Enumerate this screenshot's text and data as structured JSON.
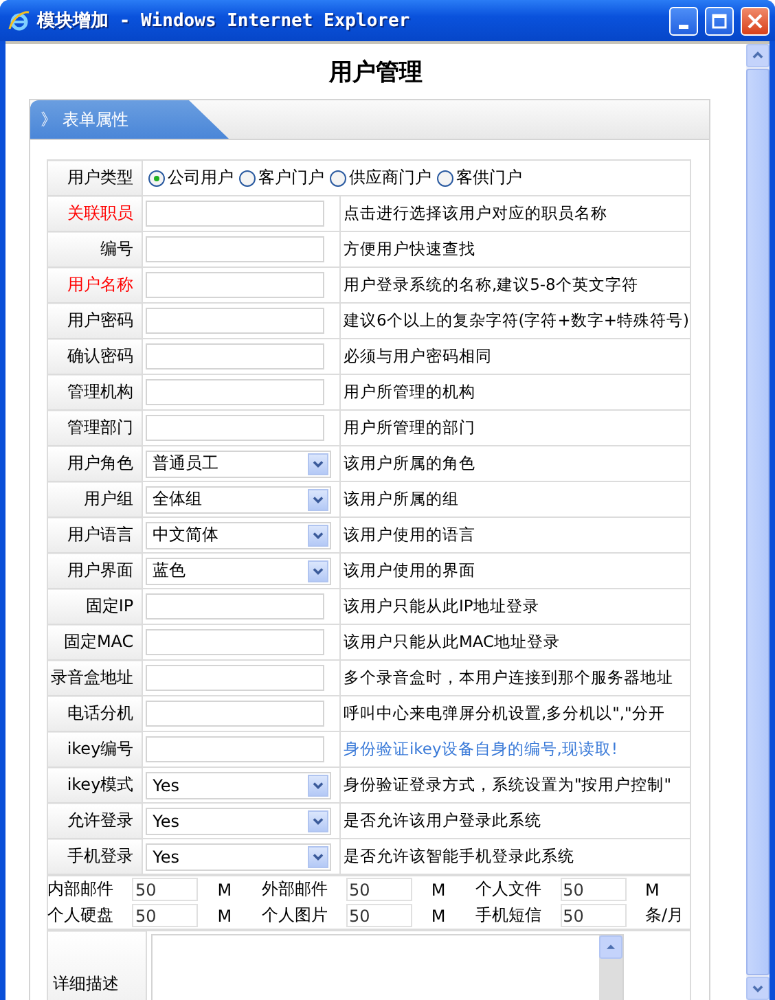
{
  "window": {
    "title": "模块增加 - Windows Internet Explorer"
  },
  "page_title": "用户管理",
  "panel": {
    "tab": "》 表单属性"
  },
  "fields": [
    {
      "kind": "radio",
      "label": "用户类型",
      "required": false,
      "options": [
        {
          "label": "公司用户",
          "selected": true
        },
        {
          "label": "客户门户",
          "selected": false
        },
        {
          "label": "供应商门户",
          "selected": false
        },
        {
          "label": "客供门户",
          "selected": false
        }
      ]
    },
    {
      "kind": "text",
      "label": "关联职员",
      "required": true,
      "hint": {
        "text": "点击进行选择该用户对应的职员名称",
        "kind": "plain"
      }
    },
    {
      "kind": "text",
      "label": "编号",
      "required": false,
      "hint": {
        "text": "方便用户快速查找",
        "kind": "plain"
      }
    },
    {
      "kind": "text",
      "label": "用户名称",
      "required": true,
      "hint": {
        "text": "用户登录系统的名称,建议5-8个英文字符",
        "kind": "plain"
      }
    },
    {
      "kind": "text",
      "label": "用户密码",
      "required": false,
      "hint": {
        "text": "建议6个以上的复杂字符(字符+数字+特殊符号)",
        "kind": "plain"
      }
    },
    {
      "kind": "text",
      "label": "确认密码",
      "required": false,
      "hint": {
        "text": "必须与用户密码相同",
        "kind": "plain"
      }
    },
    {
      "kind": "text",
      "label": "管理机构",
      "required": false,
      "hint": {
        "text": "用户所管理的机构",
        "kind": "plain"
      }
    },
    {
      "kind": "text",
      "label": "管理部门",
      "required": false,
      "hint": {
        "text": "用户所管理的部门",
        "kind": "plain"
      }
    },
    {
      "kind": "select",
      "label": "用户角色",
      "required": false,
      "value": "普通员工",
      "hint": {
        "text": "该用户所属的角色",
        "kind": "plain"
      }
    },
    {
      "kind": "select",
      "label": "用户组",
      "required": false,
      "value": "全体组",
      "hint": {
        "text": "该用户所属的组",
        "kind": "plain"
      }
    },
    {
      "kind": "select",
      "label": "用户语言",
      "required": false,
      "value": "中文简体",
      "hint": {
        "text": "该用户使用的语言",
        "kind": "plain"
      }
    },
    {
      "kind": "select",
      "label": "用户界面",
      "required": false,
      "value": "蓝色",
      "hint": {
        "text": "该用户使用的界面",
        "kind": "plain"
      }
    },
    {
      "kind": "text",
      "label": "固定IP",
      "required": false,
      "hint": {
        "text": "该用户只能从此IP地址登录",
        "kind": "plain"
      }
    },
    {
      "kind": "text",
      "label": "固定MAC",
      "required": false,
      "hint": {
        "text": "该用户只能从此MAC地址登录",
        "kind": "plain"
      }
    },
    {
      "kind": "text",
      "label": "录音盒地址",
      "required": false,
      "hint": {
        "text": "多个录音盒时，本用户连接到那个服务器地址",
        "kind": "plain"
      }
    },
    {
      "kind": "text",
      "label": "电话分机",
      "required": false,
      "hint": {
        "text": "呼叫中心来电弹屏分机设置,多分机以\",\"分开",
        "kind": "plain"
      }
    },
    {
      "kind": "text",
      "label": "ikey编号",
      "required": false,
      "hint": {
        "text": "身份验证ikey设备自身的编号,现读取!",
        "kind": "link"
      }
    },
    {
      "kind": "select",
      "label": "ikey模式",
      "required": false,
      "value": "Yes",
      "hint": {
        "text": "身份验证登录方式，系统设置为\"按用户控制\"",
        "kind": "plain"
      }
    },
    {
      "kind": "select",
      "label": "允许登录",
      "required": false,
      "value": "Yes",
      "hint": {
        "text": "是否允许该用户登录此系统",
        "kind": "plain"
      }
    },
    {
      "kind": "select",
      "label": "手机登录",
      "required": false,
      "value": "Yes",
      "hint": {
        "text": "是否允许该智能手机登录此系统",
        "kind": "plain"
      }
    }
  ],
  "quotas": [
    [
      {
        "label": "内部邮件",
        "value": "50",
        "unit": "M"
      },
      {
        "label": "外部邮件",
        "value": "50",
        "unit": "M"
      },
      {
        "label": "个人文件",
        "value": "50",
        "unit": "M"
      }
    ],
    [
      {
        "label": "个人硬盘",
        "value": "50",
        "unit": "M"
      },
      {
        "label": "个人图片",
        "value": "50",
        "unit": "M"
      },
      {
        "label": "手机短信",
        "value": "50",
        "unit": "条/月"
      }
    ]
  ],
  "description": {
    "label": "详细描述"
  }
}
